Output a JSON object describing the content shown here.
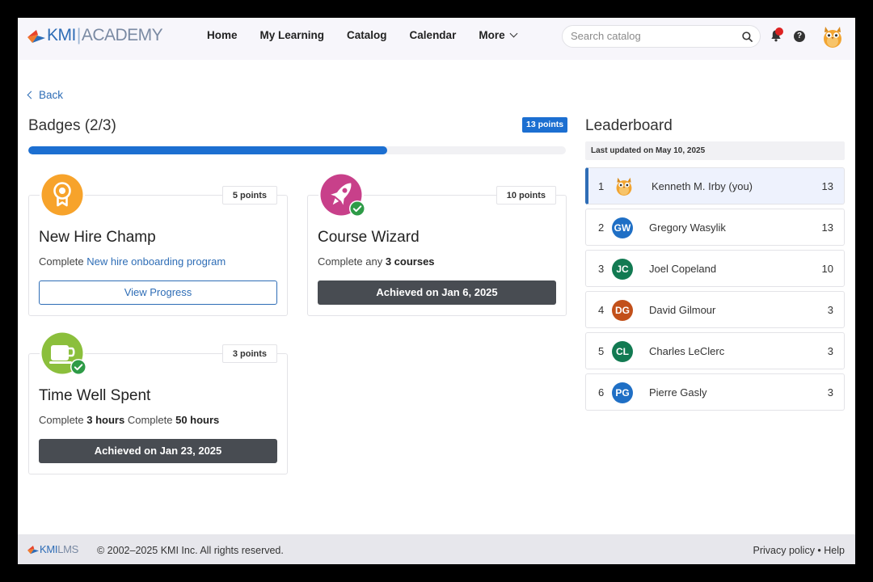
{
  "header": {
    "logo": {
      "brand": "KMI",
      "separator": "|",
      "product": "ACADEMY"
    },
    "nav": [
      "Home",
      "My Learning",
      "Catalog",
      "Calendar",
      "More"
    ],
    "search_placeholder": "Search catalog",
    "help_label": "?"
  },
  "back_label": "Back",
  "badges": {
    "title": "Badges (2/3)",
    "total_points": "13 points",
    "progress_fraction": 0.667,
    "cards": [
      {
        "points": "5 points",
        "title": "New Hire Champ",
        "desc_prefix": "Complete ",
        "desc_link": "New hire onboarding program",
        "button": "View Progress",
        "color": "#f7a32b"
      },
      {
        "points": "10 points",
        "title": "Course Wizard",
        "desc_prefix": "Complete any ",
        "desc_bold": "3 courses",
        "achieved": "Achieved on Jan 6, 2025",
        "color": "#c8408a"
      },
      {
        "points": "3 points",
        "title": "Time Well Spent",
        "desc_prefix": "Complete ",
        "desc_bold1": "3 hours",
        "desc_mid": " Complete ",
        "desc_bold2": "50 hours",
        "achieved": "Achieved on Jan 23, 2025",
        "color": "#8bbf3c"
      }
    ]
  },
  "leaderboard": {
    "title": "Leaderboard",
    "updated": "Last updated on May 10, 2025",
    "rows": [
      {
        "rank": "1",
        "initials": "",
        "name": "Kenneth M. Irby (you)",
        "score": "13",
        "color": "#f0a830"
      },
      {
        "rank": "2",
        "initials": "GW",
        "name": "Gregory Wasylik",
        "score": "13",
        "color": "#1f6fc5"
      },
      {
        "rank": "3",
        "initials": "JC",
        "name": "Joel Copeland",
        "score": "10",
        "color": "#127a52"
      },
      {
        "rank": "4",
        "initials": "DG",
        "name": "David Gilmour",
        "score": "3",
        "color": "#c2501a"
      },
      {
        "rank": "5",
        "initials": "CL",
        "name": "Charles LeClerc",
        "score": "3",
        "color": "#127a52"
      },
      {
        "rank": "6",
        "initials": "PG",
        "name": "Pierre Gasly",
        "score": "3",
        "color": "#1f6fc5"
      }
    ]
  },
  "footer": {
    "logo": {
      "brand": "KMI",
      "product": "LMS"
    },
    "copyright": "© 2002–2025 KMI Inc. All rights reserved.",
    "privacy": "Privacy policy",
    "bullet": " • ",
    "help": "Help"
  },
  "colors": {
    "accent": "#1c6fd1",
    "achieved": "#484c52",
    "success": "#2e9b47"
  }
}
